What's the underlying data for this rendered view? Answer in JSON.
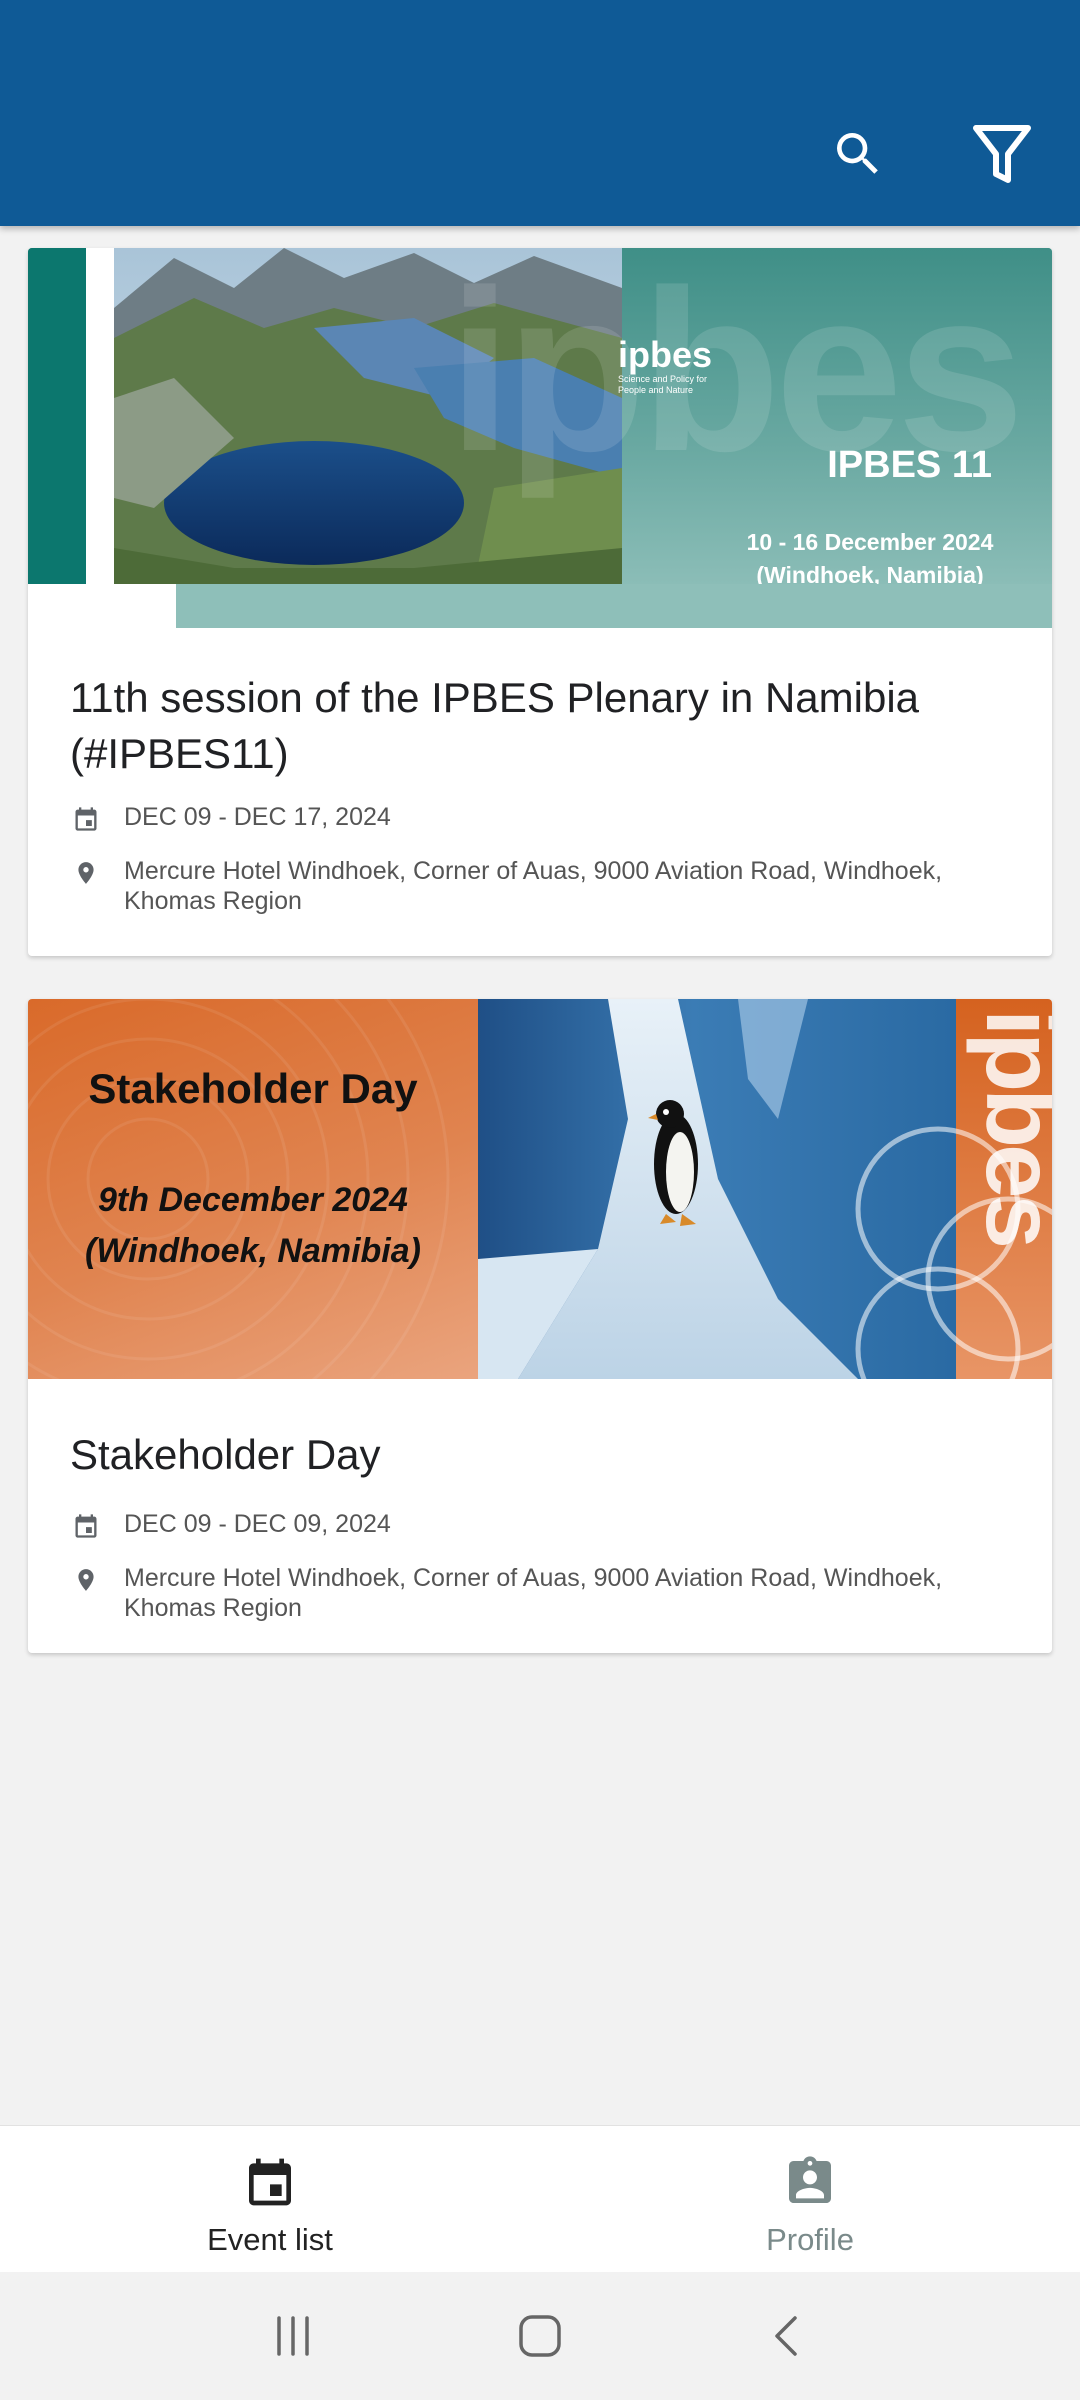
{
  "app_bar": {
    "search_icon": "search-icon",
    "filter_icon": "filter-icon",
    "color": "#0f5a96"
  },
  "events": [
    {
      "banner": {
        "logo_text": "ipbes",
        "logo_tagline": "Science and Policy for People and Nature",
        "title": "IPBES 11",
        "dates": "10 - 16 December 2024",
        "place": "(Windhoek, Namibia)"
      },
      "title": "11th session of the IPBES Plenary in Namibia (#IPBES11)",
      "date": "DEC 09 - DEC 17, 2024",
      "location": "Mercure Hotel Windhoek, Corner of Auas, 9000 Aviation Road, Windhoek, Khomas Region"
    },
    {
      "banner": {
        "title": "Stakeholder Day",
        "dates": "9th December 2024",
        "place": "(Windhoek, Namibia)",
        "vertical_text": "ipbes"
      },
      "title": "Stakeholder Day",
      "date": "DEC 09 - DEC 09, 2024",
      "location": "Mercure Hotel Windhoek, Corner of Auas, 9000 Aviation Road, Windhoek, Khomas Region"
    }
  ],
  "bottom_nav": {
    "items": [
      {
        "label": "Event list",
        "icon": "calendar-icon",
        "active": true
      },
      {
        "label": "Profile",
        "icon": "profile-badge-icon",
        "active": false
      }
    ]
  },
  "system_nav": {
    "recents_icon": "recents-icon",
    "home_icon": "home-icon",
    "back_icon": "back-icon"
  }
}
